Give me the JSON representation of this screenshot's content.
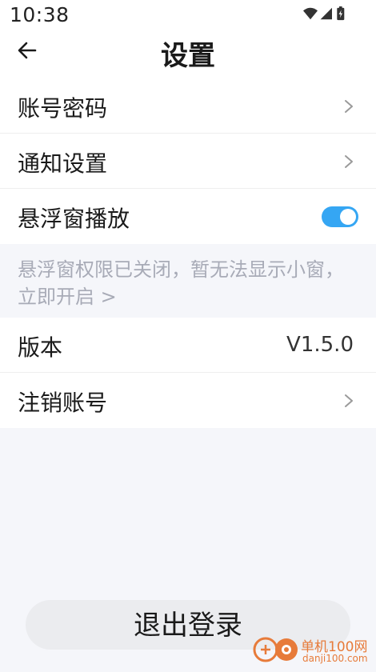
{
  "status_bar": {
    "time": "10:38",
    "icons": [
      "wifi-icon",
      "signal-icon",
      "battery-icon"
    ]
  },
  "header": {
    "back_icon": "arrow-left-icon",
    "title": "设置"
  },
  "settings_group_1": [
    {
      "label": "账号密码",
      "trailing": "chevron-right-icon"
    },
    {
      "label": "通知设置",
      "trailing": "chevron-right-icon"
    },
    {
      "label": "悬浮窗播放",
      "trailing": "toggle",
      "toggle_on": true
    }
  ],
  "notice": {
    "text": "悬浮窗权限已关闭，暂无法显示小窗，",
    "link": "立即开启 >"
  },
  "settings_group_2": [
    {
      "label": "版本",
      "value": "V1.5.0"
    },
    {
      "label": "注销账号",
      "trailing": "chevron-right-icon"
    }
  ],
  "logout": {
    "label": "退出登录"
  },
  "watermark": {
    "title": "单机100网",
    "url": "danji100.com"
  },
  "colors": {
    "accent": "#35a6f3",
    "background": "#f5f6fa",
    "notice_text": "#a8abb7",
    "button_bg": "#ebecef"
  }
}
